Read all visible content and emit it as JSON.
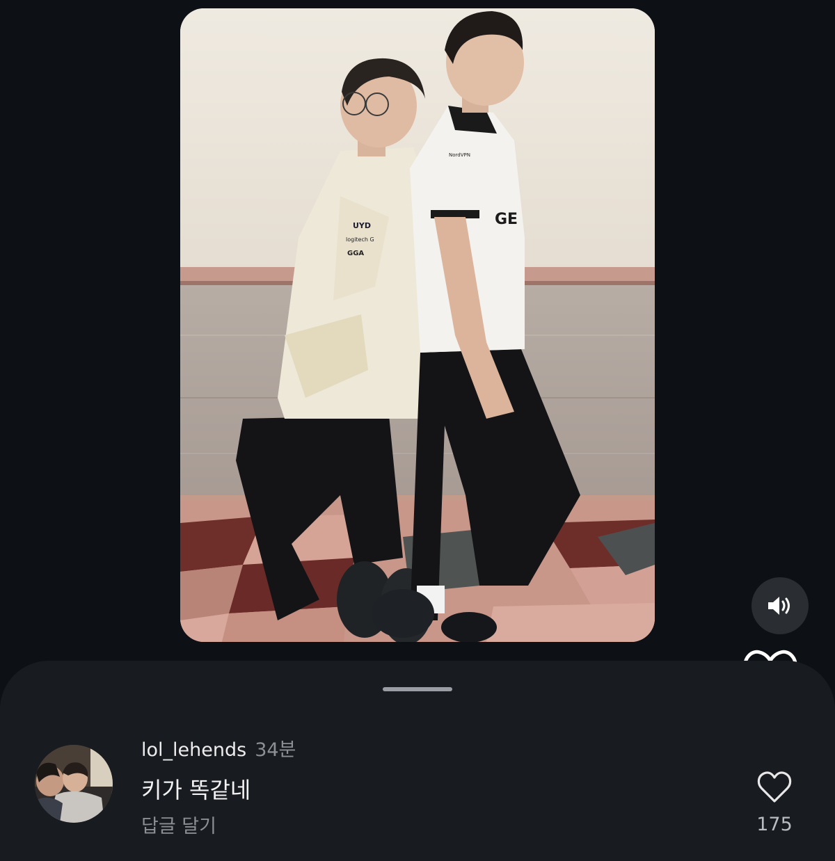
{
  "media": {
    "jersey_texts": {
      "sponsor_left_1": "UYD",
      "sponsor_left_2": "logitech G",
      "sponsor_left_3": "GGA",
      "sponsor_right_1": "NordVPN",
      "sponsor_right_2": "GE"
    }
  },
  "rail": {
    "sound_icon": "speaker-volume-icon",
    "like_icon": "heart-outline-icon"
  },
  "comment": {
    "username": "lol_lehends",
    "time_ago": "34분",
    "text": "키가 똑같네",
    "reply_label": "답글 달기",
    "like_count": "175",
    "like_icon": "heart-outline-icon"
  },
  "colors": {
    "background": "#0d1116",
    "sheet": "#181b20",
    "muted_text": "#8c8f94"
  }
}
